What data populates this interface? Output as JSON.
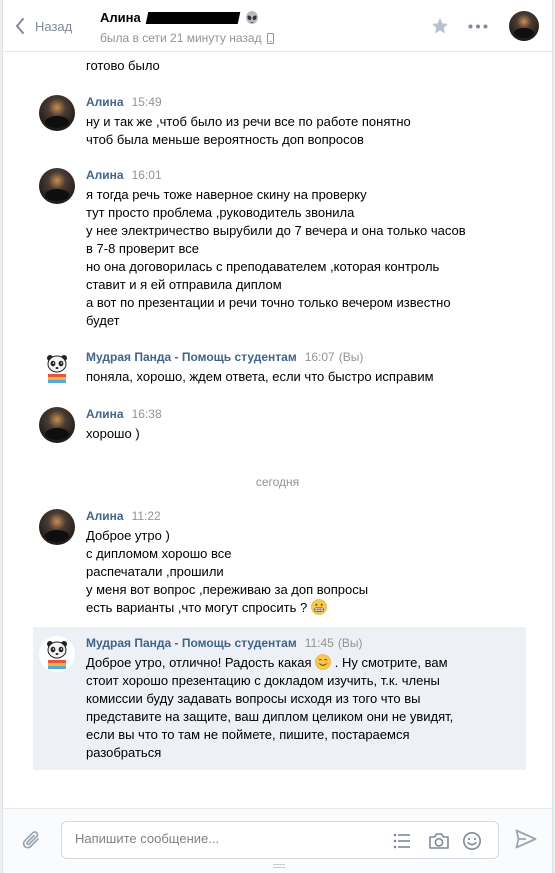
{
  "header": {
    "back_label": "Назад",
    "peer_name": "Алина",
    "peer_status": "была в сети 21 минуту назад"
  },
  "conversation": {
    "partial_text": "готово было",
    "date_separator": "сегодня",
    "you_label": "(Вы)",
    "messages": [
      {
        "author": "Алина",
        "time": "15:49",
        "lines": [
          "ну и так же ,чтоб было из речи все по работе понятно",
          "чтоб была меньше вероятность доп вопросов"
        ]
      },
      {
        "author": "Алина",
        "time": "16:01",
        "lines": [
          "я тогда речь тоже наверное скину на проверку",
          "тут просто проблема ,руководитель звонила",
          "у нее электричество вырубили до 7 вечера и она только часов",
          "в 7-8 проверит все",
          "но она договорилась с преподавателем ,которая контроль",
          "ставит и я ей отправила диплом",
          "а вот по презентации и речи точно только вечером известно",
          "будет"
        ]
      },
      {
        "author": "Мудрая Панда - Помощь студентам",
        "time": "16:07",
        "lines": [
          "поняла, хорошо, ждем ответа, если что быстро исправим"
        ]
      },
      {
        "author": "Алина",
        "time": "16:38",
        "lines": [
          "хорошо )"
        ]
      },
      {
        "author": "Алина",
        "time": "11:22",
        "lines": [
          "Доброе утро )",
          "с дипломом хорошо все",
          "распечатали ,прошили",
          "у меня вот вопрос ,переживаю за доп вопросы",
          "есть варианты ,что могут спросить ?"
        ]
      },
      {
        "author": "Мудрая Панда - Помощь студентам",
        "time": "11:45",
        "lines": [
          "Доброе утро, отлично! Радость какая",
          ". Ну смотрите, вам",
          "стоит хорошо презентацию с докладом изучить, т.к. члены",
          "комиссии буду задавать вопросы исходя из того что вы",
          "представите на защите, ваш диплом целиком они не увидят,",
          "если вы что то там не поймете, пишите, постараемся",
          "разобраться"
        ]
      }
    ]
  },
  "composer": {
    "placeholder": "Напишите сообщение..."
  },
  "colors": {
    "author": "#42648b",
    "muted": "#939393",
    "highlight": "#edf0f5",
    "icon": "#828a99"
  }
}
